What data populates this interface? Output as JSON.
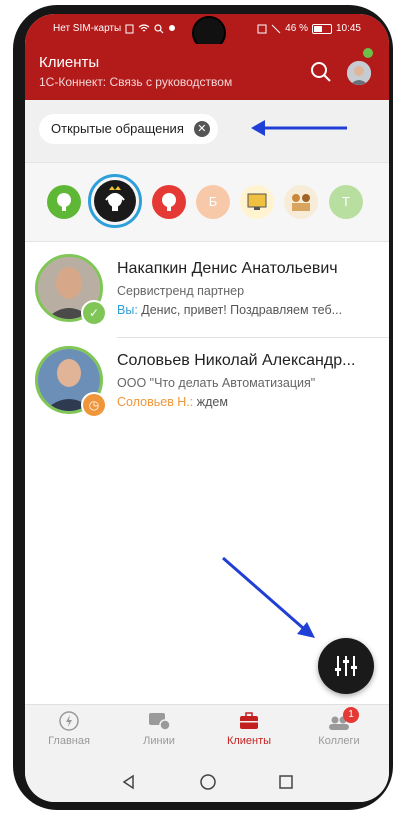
{
  "status_bar": {
    "carrier": "Нет SIM-карты",
    "battery": "46 %",
    "time": "10:45"
  },
  "app_bar": {
    "title": "Клиенты",
    "subtitle": "1С-Коннект: Связь с руководством"
  },
  "filter": {
    "chip_label": "Открытые обращения"
  },
  "channels": [
    {
      "icon": "headset-green-icon",
      "color": "#5fb835"
    },
    {
      "icon": "headset-crown-icon",
      "color": "#1a1a1a",
      "selected": true
    },
    {
      "icon": "headset-red-icon",
      "color": "#e53935"
    },
    {
      "icon": "letter-avatar",
      "letter": "Б",
      "color": "#f7c9a8"
    },
    {
      "icon": "monitor-icon",
      "color": "#f0c040"
    },
    {
      "icon": "group-photo-icon",
      "color": "#e0c080"
    },
    {
      "icon": "letter-avatar",
      "letter": "Т",
      "color": "#b8dfa0"
    }
  ],
  "clients": [
    {
      "name": "Накапкин Денис Анатольевич",
      "org": "Сервистренд партнер",
      "last_author": "Вы:",
      "last_text": " Денис, привет! Поздравляем теб...",
      "author_color": "#2e9fd8",
      "status": "done",
      "status_color": "#7fc657"
    },
    {
      "name": "Соловьев Николай Александр...",
      "org": "ООО \"Что делать Автоматизация\"",
      "last_author": "Соловьев Н.:",
      "last_text": " ждем",
      "author_color": "#f0963a",
      "status": "waiting",
      "status_color": "#f0963a"
    }
  ],
  "bottom_nav": [
    {
      "label": "Главная",
      "icon": "lightning-icon",
      "active": false
    },
    {
      "label": "Линии",
      "icon": "chat-lines-icon",
      "active": false
    },
    {
      "label": "Клиенты",
      "icon": "briefcase-icon",
      "active": true
    },
    {
      "label": "Коллеги",
      "icon": "people-icon",
      "active": false,
      "badge": "1"
    }
  ],
  "colors": {
    "brand": "#b31b1b",
    "accent_blue": "#2e9fd8",
    "online_green": "#7fc657"
  }
}
